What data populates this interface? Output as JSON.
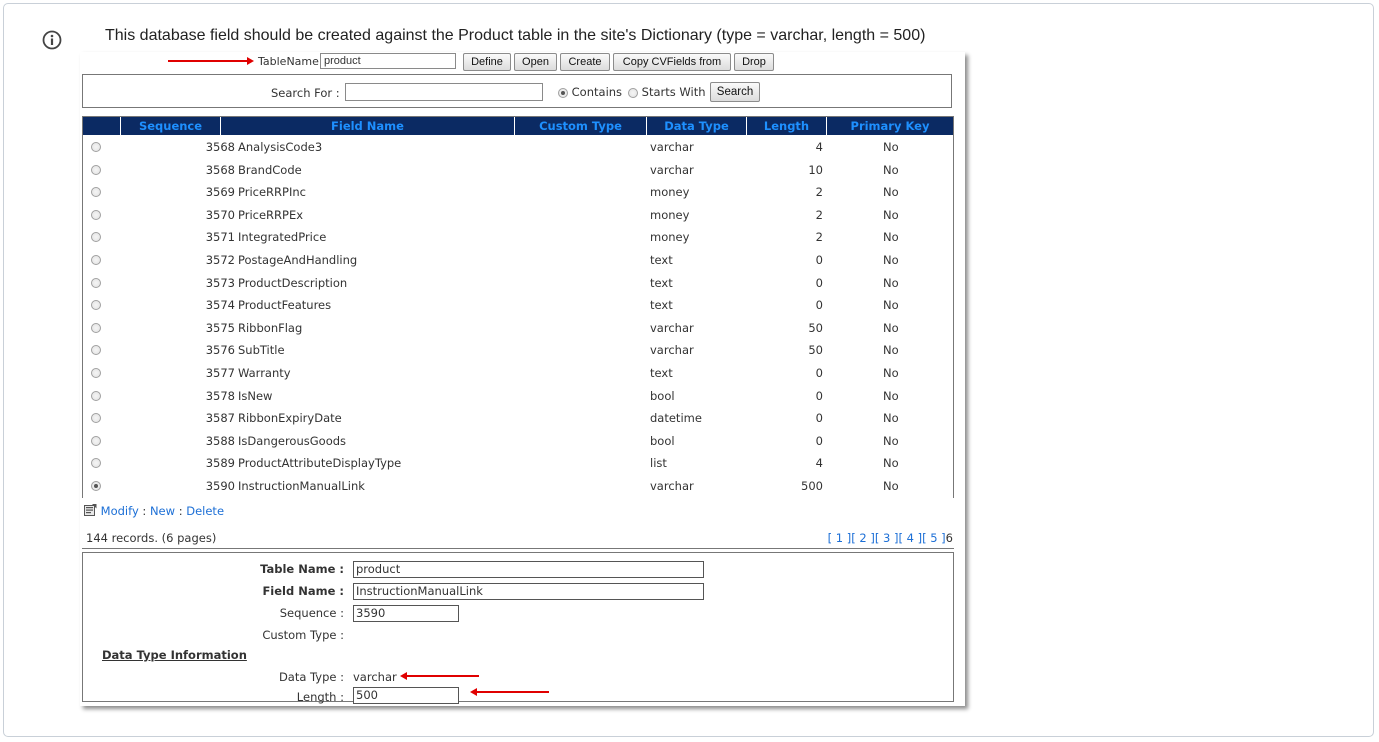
{
  "note": {
    "text": "This database field should be created against the Product table in the site's Dictionary (type = varchar, length = 500)"
  },
  "toolbar": {
    "table_label": "TableName",
    "table_value": "product",
    "buttons": {
      "define": "Define",
      "open": "Open",
      "create": "Create",
      "copy": "Copy CVFields from",
      "drop": "Drop"
    }
  },
  "search": {
    "label": "Search For :",
    "value": "",
    "contains_label": "Contains",
    "starts_label": "Starts With",
    "selected": "Contains",
    "button": "Search"
  },
  "grid": {
    "headers": {
      "sequence": "Sequence",
      "field_name": "Field Name",
      "custom_type": "Custom Type",
      "data_type": "Data Type",
      "length": "Length",
      "primary_key": "Primary Key"
    },
    "rows": [
      {
        "sequence": "3568",
        "field_name": "AnalysisCode3",
        "custom_type": "",
        "data_type": "varchar",
        "length": "4",
        "primary_key": "No",
        "selected": false
      },
      {
        "sequence": "3568",
        "field_name": "BrandCode",
        "custom_type": "",
        "data_type": "varchar",
        "length": "10",
        "primary_key": "No",
        "selected": false
      },
      {
        "sequence": "3569",
        "field_name": "PriceRRPInc",
        "custom_type": "",
        "data_type": "money",
        "length": "2",
        "primary_key": "No",
        "selected": false
      },
      {
        "sequence": "3570",
        "field_name": "PriceRRPEx",
        "custom_type": "",
        "data_type": "money",
        "length": "2",
        "primary_key": "No",
        "selected": false
      },
      {
        "sequence": "3571",
        "field_name": "IntegratedPrice",
        "custom_type": "",
        "data_type": "money",
        "length": "2",
        "primary_key": "No",
        "selected": false
      },
      {
        "sequence": "3572",
        "field_name": "PostageAndHandling",
        "custom_type": "",
        "data_type": "text",
        "length": "0",
        "primary_key": "No",
        "selected": false
      },
      {
        "sequence": "3573",
        "field_name": "ProductDescription",
        "custom_type": "",
        "data_type": "text",
        "length": "0",
        "primary_key": "No",
        "selected": false
      },
      {
        "sequence": "3574",
        "field_name": "ProductFeatures",
        "custom_type": "",
        "data_type": "text",
        "length": "0",
        "primary_key": "No",
        "selected": false
      },
      {
        "sequence": "3575",
        "field_name": "RibbonFlag",
        "custom_type": "",
        "data_type": "varchar",
        "length": "50",
        "primary_key": "No",
        "selected": false
      },
      {
        "sequence": "3576",
        "field_name": "SubTitle",
        "custom_type": "",
        "data_type": "varchar",
        "length": "50",
        "primary_key": "No",
        "selected": false
      },
      {
        "sequence": "3577",
        "field_name": "Warranty",
        "custom_type": "",
        "data_type": "text",
        "length": "0",
        "primary_key": "No",
        "selected": false
      },
      {
        "sequence": "3578",
        "field_name": "IsNew",
        "custom_type": "",
        "data_type": "bool",
        "length": "0",
        "primary_key": "No",
        "selected": false
      },
      {
        "sequence": "3587",
        "field_name": "RibbonExpiryDate",
        "custom_type": "",
        "data_type": "datetime",
        "length": "0",
        "primary_key": "No",
        "selected": false
      },
      {
        "sequence": "3588",
        "field_name": "IsDangerousGoods",
        "custom_type": "",
        "data_type": "bool",
        "length": "0",
        "primary_key": "No",
        "selected": false
      },
      {
        "sequence": "3589",
        "field_name": "ProductAttributeDisplayType",
        "custom_type": "",
        "data_type": "list",
        "length": "4",
        "primary_key": "No",
        "selected": false
      },
      {
        "sequence": "3590",
        "field_name": "InstructionManualLink",
        "custom_type": "",
        "data_type": "varchar",
        "length": "500",
        "primary_key": "No",
        "selected": true
      }
    ]
  },
  "actions": {
    "modify": "Modify",
    "sep": ":",
    "new": "New",
    "delete": "Delete"
  },
  "records": {
    "summary": "144 records. (6 pages)"
  },
  "pager": {
    "pages": [
      "[ 1 ]",
      "[ 2 ]",
      "[ 3 ]",
      "[ 4 ]",
      "[ 5 ]"
    ],
    "current": "6"
  },
  "detail": {
    "table_name_label": "Table Name :",
    "table_name_value": "product",
    "field_name_label": "Field Name :",
    "field_name_value": "InstructionManualLink",
    "sequence_label": "Sequence :",
    "sequence_value": "3590",
    "custom_type_label": "Custom Type :",
    "section_title": "Data Type Information",
    "data_type_label": "Data Type :",
    "data_type_value": "varchar",
    "length_label": "Length :",
    "length_value": "500"
  },
  "colors": {
    "header_bg": "#0b2a63",
    "header_text": "#1e90ff",
    "link": "#1c6fd6",
    "arrow": "#e00000"
  }
}
